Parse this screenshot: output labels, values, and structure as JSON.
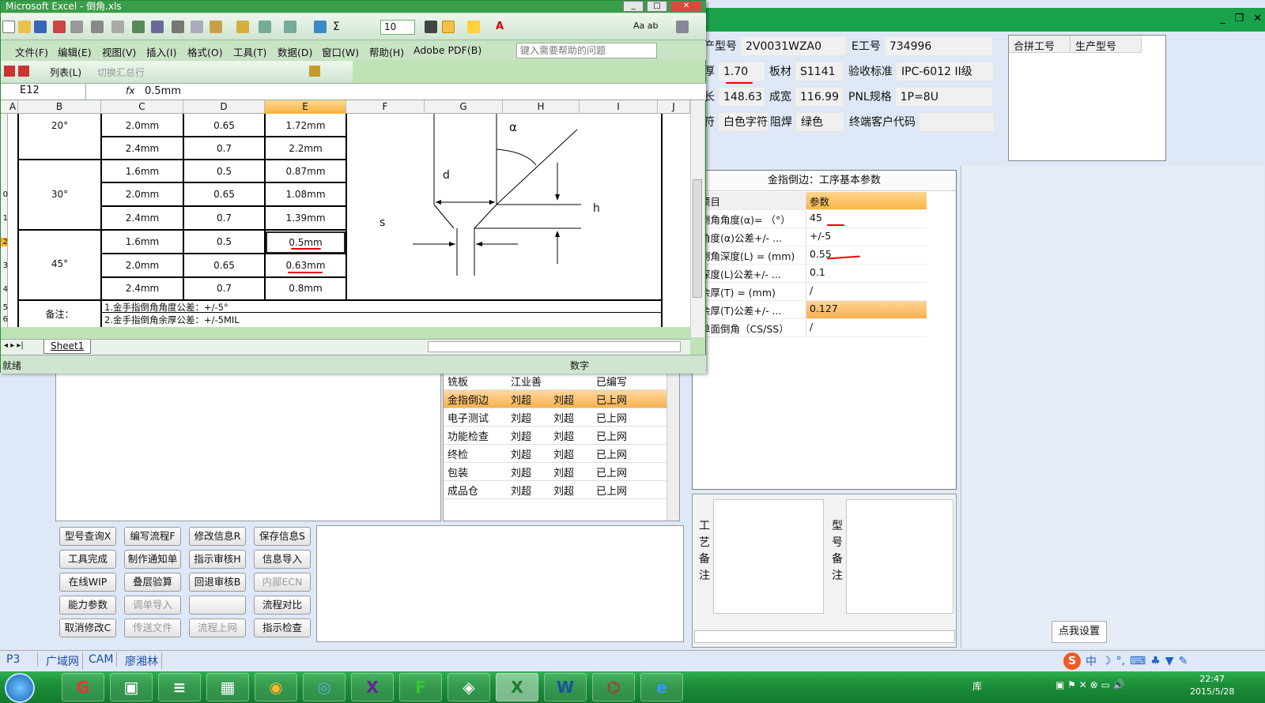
{
  "app": {
    "fields": {
      "model_label": "产型号",
      "model_value": "2V0031WZA0",
      "ework_label": "E工号",
      "ework_value": "734996",
      "thickness_label": "厚",
      "thickness_value": "1.70",
      "board_label": "板材",
      "board_value": "S1141",
      "accept_label": "验收标准",
      "accept_value": "IPC-6012 II级",
      "length_label": "长",
      "length_value": "148.63",
      "width_label": "成宽",
      "width_value": "116.99",
      "pnl_label": "PNL规格",
      "pnl_value": "1P=8U",
      "char_label": "符",
      "char_value": "白色字符",
      "mask_label": "阻焊",
      "mask_value": "绿色",
      "customer_label": "终端客户代码",
      "customer_value": ""
    },
    "merge_panel": {
      "col1": "合拼工号",
      "col2": "生产型号"
    },
    "params": {
      "title": "金指倒边：工序基本参数",
      "head": {
        "item": "项目",
        "param": "参数"
      },
      "rows": [
        {
          "item": "倒角角度(α)= （°）",
          "value": "45"
        },
        {
          "item": "角度(α)公差+/- ...",
          "value": "+/-5"
        },
        {
          "item": "倒角深度(L) = (mm)",
          "value": "0.55"
        },
        {
          "item": "深度(L)公差+/- ...",
          "value": "0.1"
        },
        {
          "item": "余厚(T) = (mm)",
          "value": "/"
        },
        {
          "item": "余厚(T)公差+/- ...",
          "value": "0.127"
        },
        {
          "item": "单面倒角（CS/SS）",
          "value": "/"
        }
      ]
    },
    "notes": {
      "craft": "工艺备注",
      "model": "型号备注"
    },
    "process_rows": [
      {
        "name": "铣板",
        "a": "江业善",
        "b": "",
        "status": "已编写"
      },
      {
        "name": "金指倒边",
        "a": "刘超",
        "b": "刘超",
        "status": "已上网"
      },
      {
        "name": "电子测试",
        "a": "刘超",
        "b": "刘超",
        "status": "已上网"
      },
      {
        "name": "功能检查",
        "a": "刘超",
        "b": "刘超",
        "status": "已上网"
      },
      {
        "name": "终检",
        "a": "刘超",
        "b": "刘超",
        "status": "已上网"
      },
      {
        "name": "包装",
        "a": "刘超",
        "b": "刘超",
        "status": "已上网"
      },
      {
        "name": "成品仓",
        "a": "刘超",
        "b": "刘超",
        "status": "已上网"
      }
    ],
    "buttons": [
      [
        "型号查询X",
        "编写流程F",
        "修改信息R",
        "保存信息S"
      ],
      [
        "工具完成",
        "制作通知单",
        "指示审核H",
        "信息导入"
      ],
      [
        "在线WIP",
        "叠层验算",
        "回退审核B",
        "内部ECN"
      ],
      [
        "能力参数",
        "调单导入",
        "",
        "流程对比"
      ],
      [
        "取消修改C",
        "传送文件",
        "流程上网",
        "指示检查"
      ]
    ],
    "settings_button": "点我设置",
    "statusbar": [
      "P3",
      "广域网",
      "CAM",
      "廖湘林"
    ]
  },
  "excel": {
    "title": "Microsoft Excel - 倒角.xls",
    "font_size": "10",
    "menu": [
      "文件(F)",
      "编辑(E)",
      "视图(V)",
      "插入(I)",
      "格式(O)",
      "工具(T)",
      "数据(D)",
      "窗口(W)",
      "帮助(H)",
      "Adobe PDF(B)"
    ],
    "help_placeholder": "键入需要帮助的问题",
    "toolbar2": {
      "list": "列表(L)",
      "toggle_total": "切换汇总行"
    },
    "namebox": "E12",
    "formula": "0.5mm",
    "columns": [
      "A",
      "B",
      "C",
      "D",
      "E",
      "F",
      "G",
      "H",
      "I",
      "J"
    ],
    "rows": [
      "",
      "",
      "",
      "0",
      "1",
      "2",
      "3",
      "4",
      "5",
      "6"
    ],
    "table": [
      {
        "angle": "20°",
        "items": [
          [
            "2.0mm",
            "0.65",
            "1.72mm"
          ],
          [
            "2.4mm",
            "0.7",
            "2.2mm"
          ]
        ]
      },
      {
        "angle": "30°",
        "items": [
          [
            "1.6mm",
            "0.5",
            "0.87mm"
          ],
          [
            "2.0mm",
            "0.65",
            "1.08mm"
          ],
          [
            "2.4mm",
            "0.7",
            "1.39mm"
          ]
        ]
      },
      {
        "angle": "45°",
        "items": [
          [
            "1.6mm",
            "0.5",
            "0.5mm"
          ],
          [
            "2.0mm",
            "0.65",
            "0.63mm"
          ],
          [
            "2.4mm",
            "0.7",
            "0.8mm"
          ]
        ]
      }
    ],
    "remark_label": "备注：",
    "remarks": [
      "1.金手指倒角角度公差：+/-5°",
      "2.金手指倒角余厚公差：+/-5MIL"
    ],
    "diagram": {
      "alpha": "α",
      "d": "d",
      "h": "h",
      "s": "s"
    },
    "sheet_tab": "Sheet1",
    "status_ready": "就绪",
    "status_num": "数字"
  },
  "taskbar": {
    "tray_label": "库",
    "time": "22:47",
    "date": "2015/5/28"
  }
}
